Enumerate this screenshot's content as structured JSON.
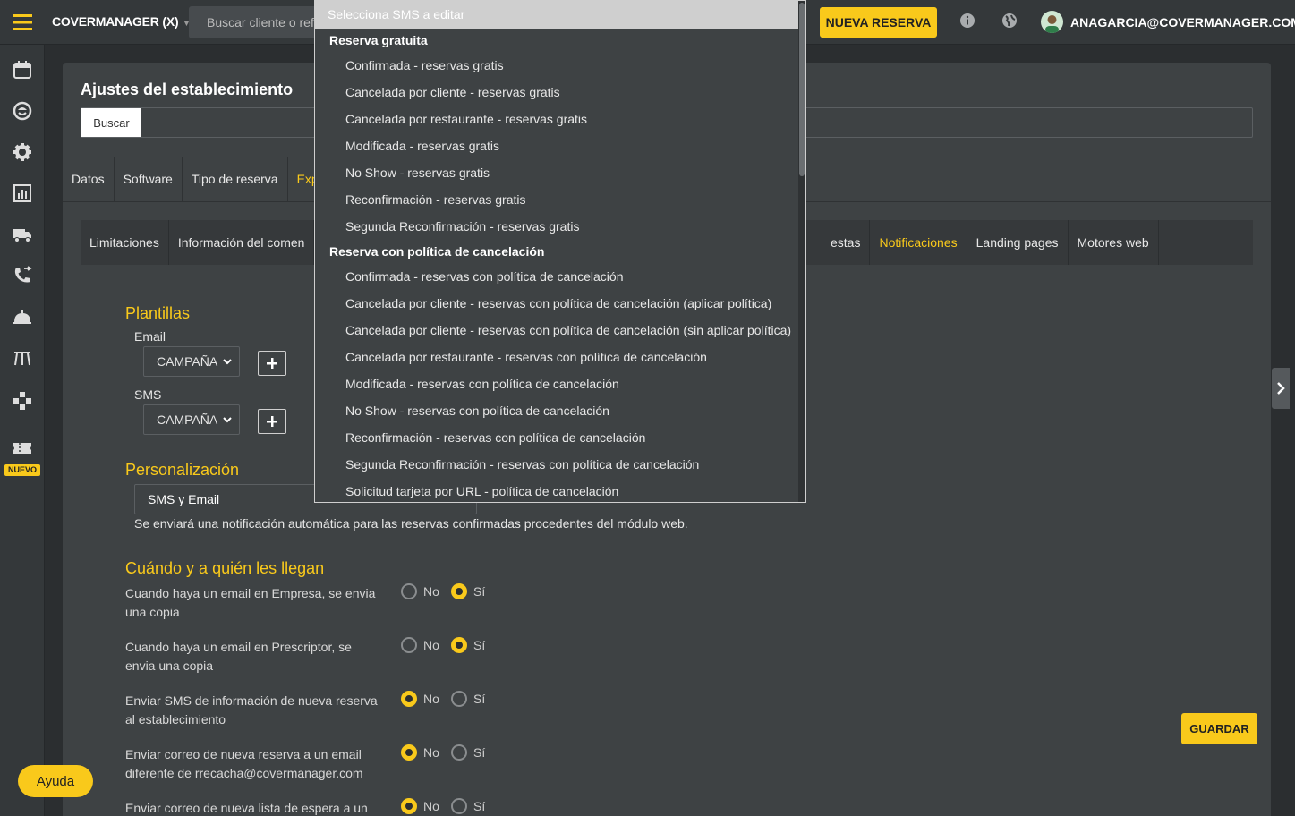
{
  "colors": {
    "accent": "#f9c91b",
    "bg": "#2b2e30",
    "panel": "#3e4244"
  },
  "topbar": {
    "brand": "COVERMANAGER (X)",
    "search_placeholder": "Buscar cliente o ref",
    "new_booking": "NUEVA RESERVA",
    "user_email": "ANAGARCIA@COVERMANAGER.COM"
  },
  "sidebar": {
    "nuevo_badge": "NUEVO"
  },
  "page": {
    "title": "Ajustes del establecimiento",
    "search_button": "Buscar",
    "tabs": [
      "Datos",
      "Software",
      "Tipo de reserva",
      "Exp"
    ],
    "subtabs_left": [
      "Limitaciones",
      "Información del comen"
    ],
    "subtabs_right": [
      "estas",
      "Notificaciones",
      "Landing pages",
      "Motores web"
    ]
  },
  "plantillas": {
    "title": "Plantillas",
    "email_label": "Email",
    "email_value": "CAMPAÑA",
    "sms_label": "SMS",
    "sms_value": "CAMPAÑA"
  },
  "personalizacion": {
    "title": "Personalización",
    "value": "SMS y Email",
    "help": "Se enviará una notificación automática para las reservas confirmadas procedentes del módulo web."
  },
  "cuando": {
    "title": "Cuándo y a quién les llegan",
    "no": "No",
    "si": "Sí",
    "questions": [
      {
        "text": "Cuando haya un email en Empresa, se envia una copia",
        "selected": "si"
      },
      {
        "text": "Cuando haya un email en Prescriptor, se envia una copia",
        "selected": "si"
      },
      {
        "text": "Enviar SMS de información de nueva reserva al establecimiento",
        "selected": "no"
      },
      {
        "text": "Enviar correo de nueva reserva a un email diferente de rrecacha@covermanager.com",
        "selected": "no"
      },
      {
        "text": "Enviar correo de nueva lista de espera a un",
        "selected": "no"
      }
    ]
  },
  "buttons": {
    "guardar": "GUARDAR",
    "ayuda": "Ayuda"
  },
  "dropdown": {
    "header": "Selecciona SMS a editar",
    "groups": [
      {
        "label": "Reserva gratuita",
        "items": [
          "Confirmada - reservas gratis",
          "Cancelada por cliente - reservas gratis",
          "Cancelada por restaurante - reservas gratis",
          "Modificada - reservas gratis",
          "No Show - reservas gratis",
          "Reconfirmación - reservas gratis",
          "Segunda Reconfirmación - reservas gratis"
        ]
      },
      {
        "label": "Reserva con política de cancelación",
        "items": [
          "Confirmada - reservas con política de cancelación",
          "Cancelada por cliente - reservas con política de cancelación (aplicar política)",
          "Cancelada por cliente - reservas con política de cancelación (sin aplicar política)",
          "Cancelada por restaurante - reservas con política de cancelación",
          "Modificada - reservas con política de cancelación",
          "No Show - reservas con política de cancelación",
          "Reconfirmación - reservas con política de cancelación",
          "Segunda Reconfirmación - reservas con política de cancelación",
          "Solicitud tarjeta por URL - política de cancelación"
        ]
      }
    ]
  }
}
